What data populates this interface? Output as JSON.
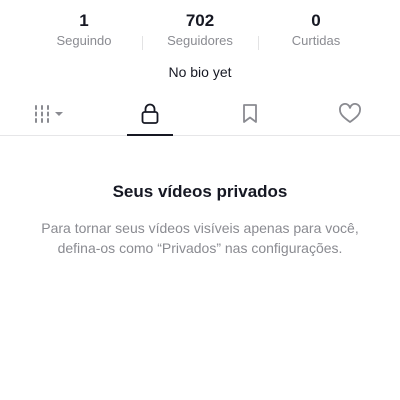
{
  "stats": {
    "following": {
      "count": "1",
      "label": "Seguindo"
    },
    "followers": {
      "count": "702",
      "label": "Seguidores"
    },
    "likes": {
      "count": "0",
      "label": "Curtidas"
    }
  },
  "bio": {
    "text": "No bio yet"
  },
  "tabs": {
    "items": [
      {
        "icon": "videos-grid-icon",
        "active": false
      },
      {
        "icon": "lock-icon",
        "active": true
      },
      {
        "icon": "bookmark-icon",
        "active": false
      },
      {
        "icon": "heart-icon",
        "active": false
      }
    ]
  },
  "empty_state": {
    "title": "Seus vídeos privados",
    "description": "Para tornar seus vídeos visíveis apenas para você, defina-os como “Privados” nas configurações."
  },
  "colors": {
    "primary_text": "#161823",
    "secondary_text": "#8a8b91",
    "divider": "#e6e6e8"
  }
}
